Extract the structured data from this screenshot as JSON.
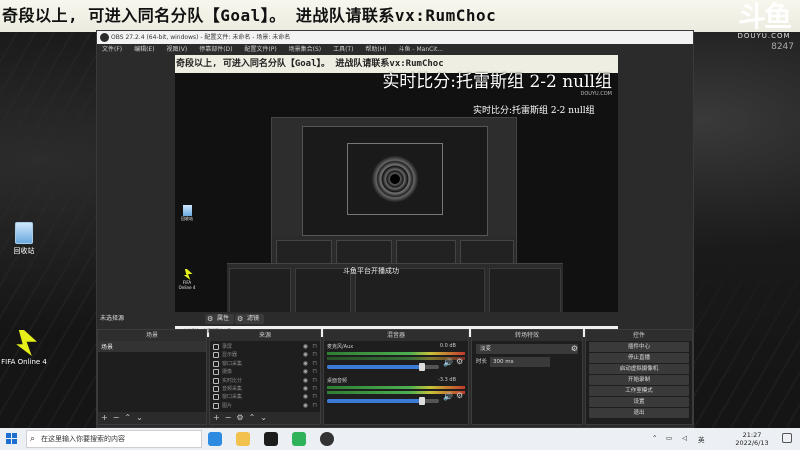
{
  "banner": {
    "text": "奇段以上, 可进入同名分队【Goal】。 进战队请联系vx:RumChoc"
  },
  "brand": {
    "logo": "斗鱼",
    "site": "DOUYU.COM",
    "room": "8247"
  },
  "desktop_icons": {
    "recycle_bin": "回收站",
    "fifa": "FIFA Online 4"
  },
  "obs": {
    "title": "OBS 27.2.4 (64-bit, windows) - 配置文件: 未命名 - 场景: 未命名",
    "menu": [
      "文件(F)",
      "编辑(E)",
      "视图(V)",
      "停靠部件(D)",
      "配置文件(P)",
      "场景集合(S)",
      "工具(T)",
      "帮助(H)",
      "斗鱼 - ManCit..."
    ],
    "preview": {
      "banner": "奇段以上, 可进入同名分队【Goal】。 进战队请联系vx:RumChoc",
      "score_overlay": "实时比分:托雷斯组 2-2 null组",
      "nested_score": "实时比分:托雷斯组 2-2 null组",
      "nested_toast": "斗鱼平台开播成功",
      "nested_taskbar_search": "在这里输入你要搜索的内容",
      "logo": "DOUYU.COM",
      "icons": {
        "recycle_bin": "回收站",
        "fifa": "FIFA Online 4"
      }
    },
    "status": {
      "no_source": "未选择源",
      "properties_label": "属性",
      "filters_label": "滤镜"
    },
    "scenes": {
      "title": "场景",
      "items": [
        "场景"
      ]
    },
    "sources": {
      "title": "来源",
      "items": [
        "录屏",
        "显示器",
        "窗口采集",
        "摄像",
        "实时比分",
        "音频采集",
        "窗口采集",
        "图片"
      ]
    },
    "mixer": {
      "title": "混音器",
      "tracks": [
        {
          "name": "麦克风/Aux",
          "db": "0.0 dB",
          "level": 0.85
        },
        {
          "name": "桌面音频",
          "db": "-3.3 dB",
          "level": 0.85
        }
      ]
    },
    "transitions": {
      "title": "转场特效",
      "selected": "淡变",
      "duration_label": "时长",
      "duration_value": "300 ms"
    },
    "controls": {
      "title": "控件",
      "buttons": [
        "插件中心",
        "停止直播",
        "启动虚拟摄像机",
        "开始录制",
        "工作室模式",
        "设置",
        "退出"
      ]
    }
  },
  "taskbar": {
    "search_placeholder": "在这里输入你要搜索的内容",
    "ime": "英",
    "time": "21:27",
    "date": "2022/6/13"
  }
}
